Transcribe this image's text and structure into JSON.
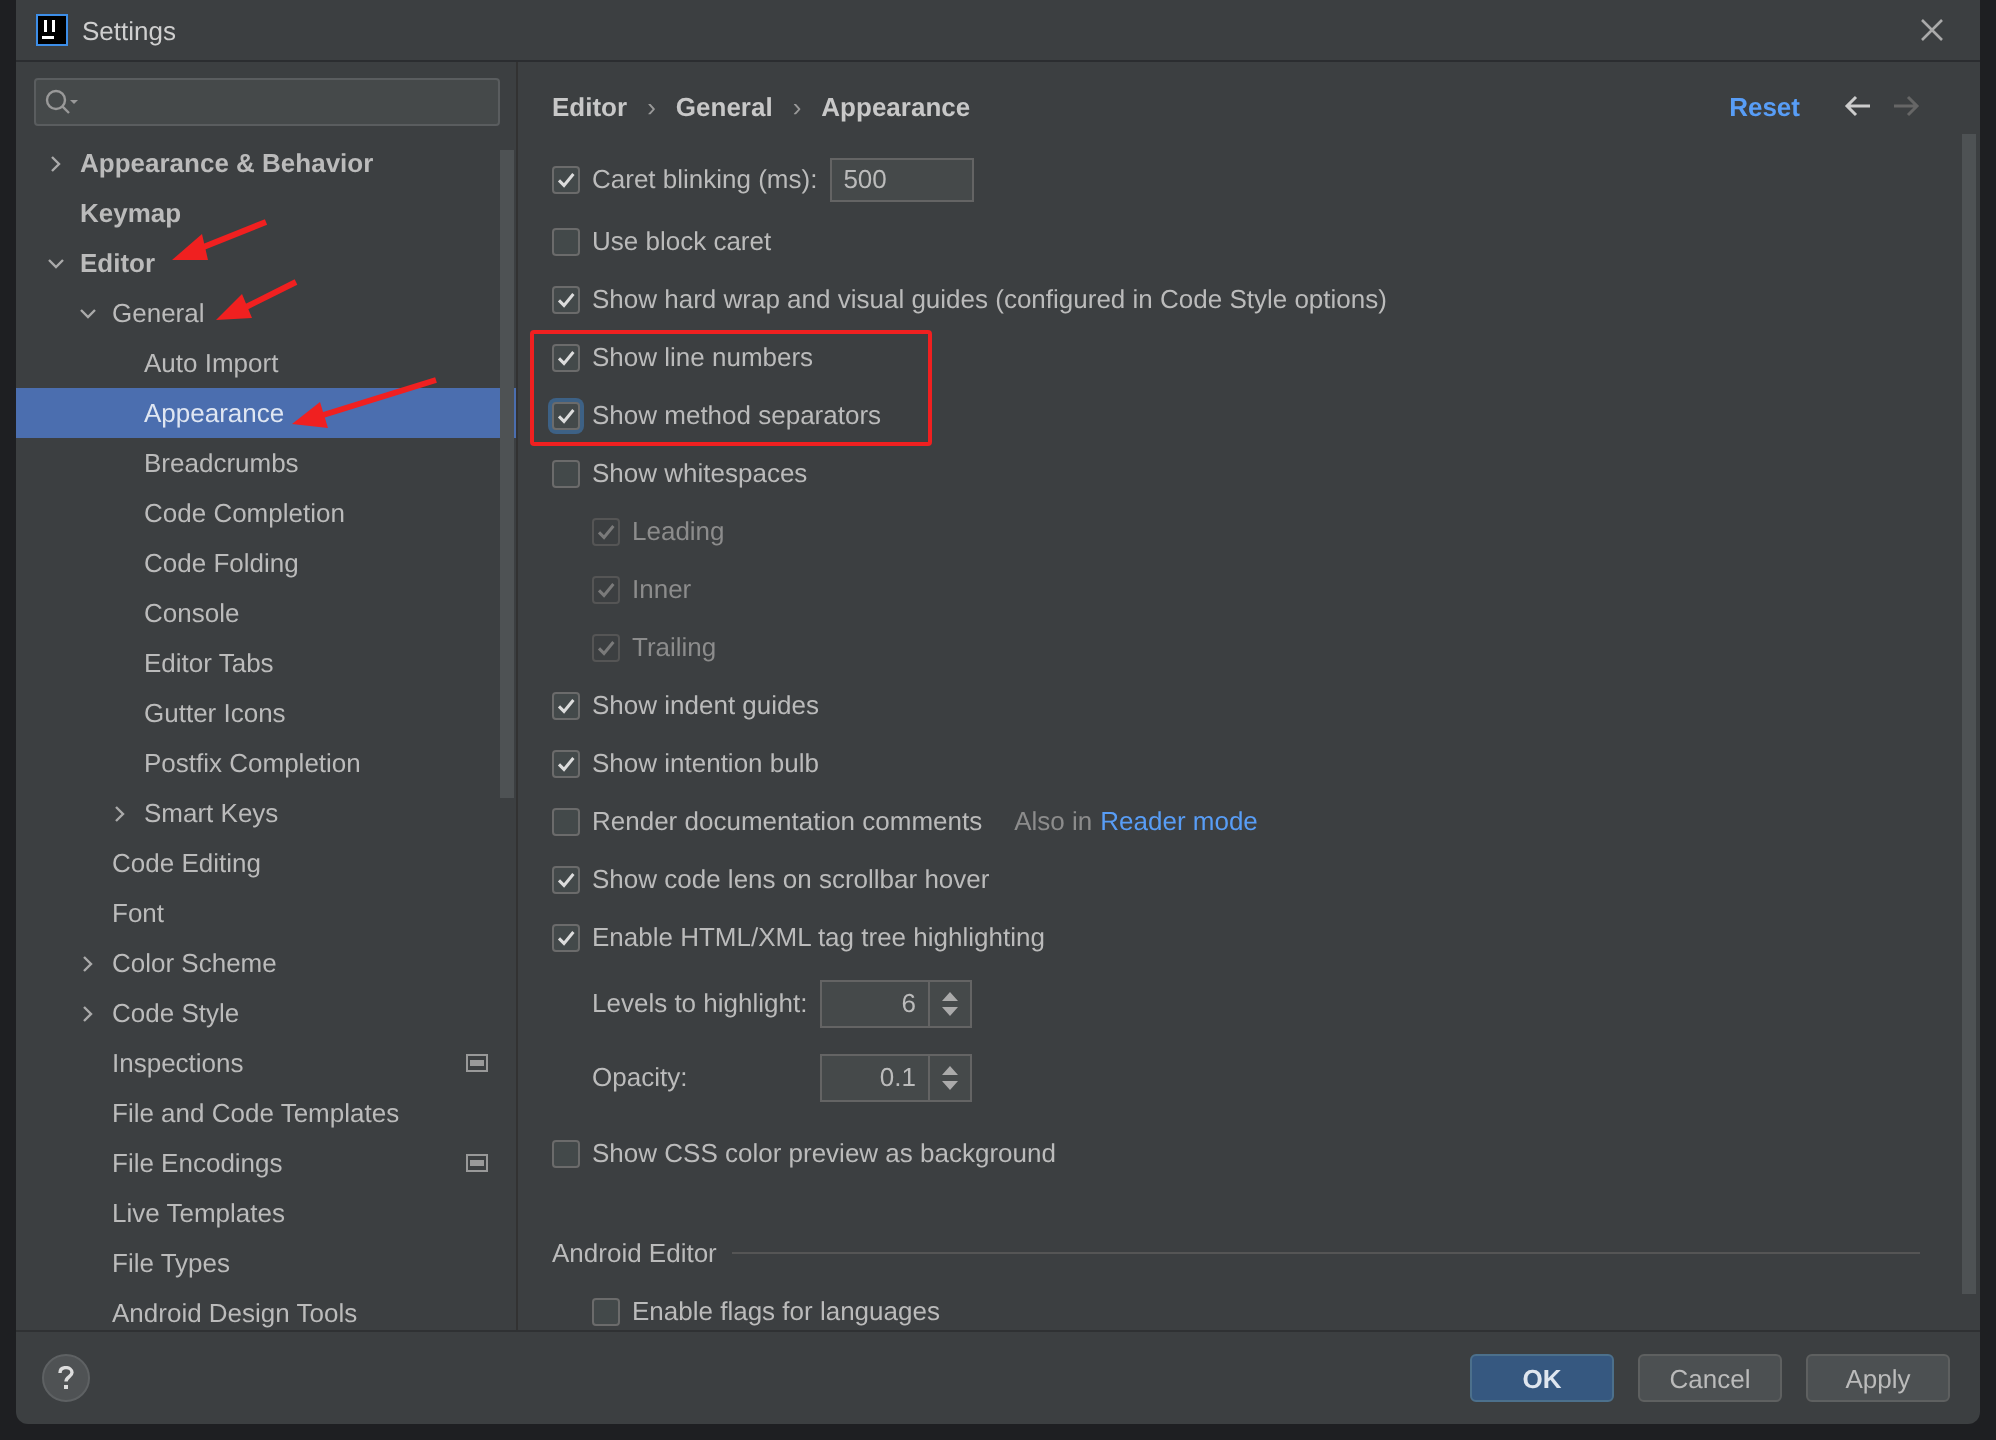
{
  "window": {
    "title": "Settings"
  },
  "sidebar": {
    "items": [
      {
        "label": "Appearance & Behavior",
        "selected": false,
        "expanded": false
      },
      {
        "label": "Keymap",
        "selected": false
      },
      {
        "label": "Editor",
        "selected": false,
        "expanded": true,
        "children": [
          {
            "label": "General",
            "selected": false,
            "expanded": true,
            "children": [
              {
                "label": "Auto Import",
                "selected": false
              },
              {
                "label": "Appearance",
                "selected": true
              },
              {
                "label": "Breadcrumbs",
                "selected": false
              },
              {
                "label": "Code Completion",
                "selected": false
              },
              {
                "label": "Code Folding",
                "selected": false
              },
              {
                "label": "Console",
                "selected": false
              },
              {
                "label": "Editor Tabs",
                "selected": false
              },
              {
                "label": "Gutter Icons",
                "selected": false
              },
              {
                "label": "Postfix Completion",
                "selected": false
              },
              {
                "label": "Smart Keys",
                "selected": false,
                "expanded": false
              }
            ]
          },
          {
            "label": "Code Editing",
            "selected": false
          },
          {
            "label": "Font",
            "selected": false
          },
          {
            "label": "Color Scheme",
            "selected": false,
            "expanded": false
          },
          {
            "label": "Code Style",
            "selected": false,
            "expanded": false
          },
          {
            "label": "Inspections",
            "selected": false,
            "project_scope": true
          },
          {
            "label": "File and Code Templates",
            "selected": false
          },
          {
            "label": "File Encodings",
            "selected": false,
            "project_scope": true
          },
          {
            "label": "Live Templates",
            "selected": false
          },
          {
            "label": "File Types",
            "selected": false
          },
          {
            "label": "Android Design Tools",
            "selected": false
          }
        ]
      }
    ]
  },
  "breadcrumb": [
    "Editor",
    "›",
    "General",
    "›",
    "Appearance"
  ],
  "reset_link": "Reset",
  "options": [
    {
      "kind": "checkbox_field",
      "label": "Caret blinking (ms):",
      "checked": true,
      "value": "500"
    },
    {
      "kind": "checkbox",
      "label": "Use block caret",
      "checked": false
    },
    {
      "kind": "checkbox",
      "label": "Show hard wrap and visual guides (configured in Code Style options)",
      "checked": true
    },
    {
      "kind": "checkbox",
      "label": "Show line numbers",
      "checked": true
    },
    {
      "kind": "checkbox",
      "label": "Show method separators",
      "checked": true,
      "focused": true
    },
    {
      "kind": "checkbox",
      "label": "Show whitespaces",
      "checked": false,
      "children": [
        {
          "kind": "checkbox",
          "label": "Leading",
          "checked": true,
          "disabled": true
        },
        {
          "kind": "checkbox",
          "label": "Inner",
          "checked": true,
          "disabled": true
        },
        {
          "kind": "checkbox",
          "label": "Trailing",
          "checked": true,
          "disabled": true
        }
      ]
    },
    {
      "kind": "checkbox",
      "label": "Show indent guides",
      "checked": true
    },
    {
      "kind": "checkbox",
      "label": "Show intention bulb",
      "checked": true
    },
    {
      "kind": "checkbox",
      "label": "Render documentation comments",
      "checked": false,
      "note": "Also in",
      "link": "Reader mode"
    },
    {
      "kind": "checkbox",
      "label": "Show code lens on scrollbar hover",
      "checked": true
    },
    {
      "kind": "checkbox",
      "label": "Enable HTML/XML tag tree highlighting",
      "checked": true,
      "children": [
        {
          "kind": "spinner",
          "label": "Levels to highlight:",
          "value": "6"
        },
        {
          "kind": "spinner",
          "label": "Opacity:",
          "value": "0.1"
        }
      ]
    },
    {
      "kind": "checkbox",
      "label": "Show CSS color preview as background",
      "checked": false
    },
    {
      "kind": "section",
      "label": "Android Editor",
      "children": [
        {
          "kind": "checkbox",
          "label": "Enable flags for languages",
          "checked": false
        }
      ]
    }
  ],
  "buttons": [
    {
      "label": "OK",
      "kind": "default"
    },
    {
      "label": "Cancel",
      "kind": "normal"
    },
    {
      "label": "Apply",
      "kind": "normal"
    }
  ]
}
